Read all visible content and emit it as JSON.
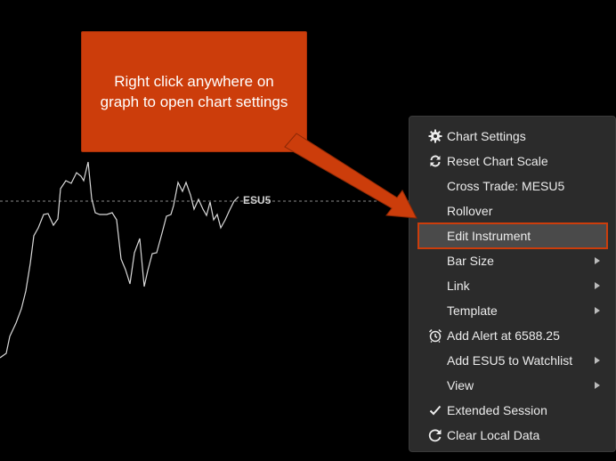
{
  "chart": {
    "symbol": "ESU5",
    "line_color": "#d9d9d9",
    "price_line_color": "#8a8a8a"
  },
  "callout": {
    "text": "Right click anywhere on\ngraph to open chart settings",
    "color": "#cc3d0b"
  },
  "menu": {
    "chart_settings": "Chart Settings",
    "reset_chart_scale": "Reset Chart Scale",
    "cross_trade": "Cross Trade: MESU5",
    "rollover": "Rollover",
    "edit_instrument": "Edit Instrument",
    "bar_size": "Bar Size",
    "link": "Link",
    "template": "Template",
    "add_alert": "Add Alert at 6588.25",
    "add_to_watchlist": "Add ESU5 to Watchlist",
    "view": "View",
    "extended_session": "Extended Session",
    "clear_local_data": "Clear Local Data",
    "icons": {
      "chart_settings": "gear-icon",
      "reset_chart_scale": "refresh-icon",
      "add_alert": "alarm-clock-icon",
      "extended_session": "checkmark-icon",
      "clear_local_data": "reload-icon"
    }
  }
}
